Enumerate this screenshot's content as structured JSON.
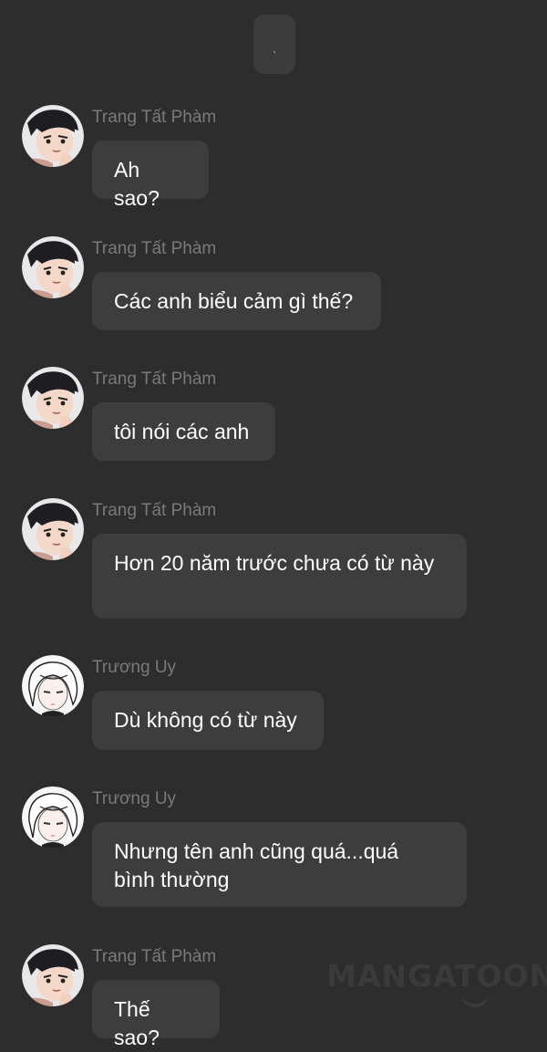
{
  "top_indicator": ".",
  "messages": [
    {
      "sender": "Trang Tất Phàm",
      "text": "Ah sao?",
      "avatar": "man-avatar"
    },
    {
      "sender": "Trang Tất Phàm",
      "text": "Các anh biểu cảm gì thế?",
      "avatar": "man-avatar"
    },
    {
      "sender": "Trang Tất Phàm",
      "text": "tôi nói các anh",
      "avatar": "man-avatar"
    },
    {
      "sender": "Trang Tất Phàm",
      "text": "Hơn 20 năm trước chưa có từ này",
      "avatar": "man-avatar"
    },
    {
      "sender": "Trương Uy",
      "text": "Dù không có từ này",
      "avatar": "white-hair-avatar"
    },
    {
      "sender": "Trương Uy",
      "text": "Nhưng tên anh cũng quá...quá bình thường",
      "avatar": "white-hair-avatar"
    },
    {
      "sender": "Trang Tất Phàm",
      "text": "Thế sao?",
      "avatar": "man-avatar"
    }
  ],
  "watermark": "MANGATOON",
  "colors": {
    "background": "#2d2d2d",
    "bubble": "#3d3d3d",
    "sender": "#7a7a7a",
    "text": "#ffffff"
  }
}
